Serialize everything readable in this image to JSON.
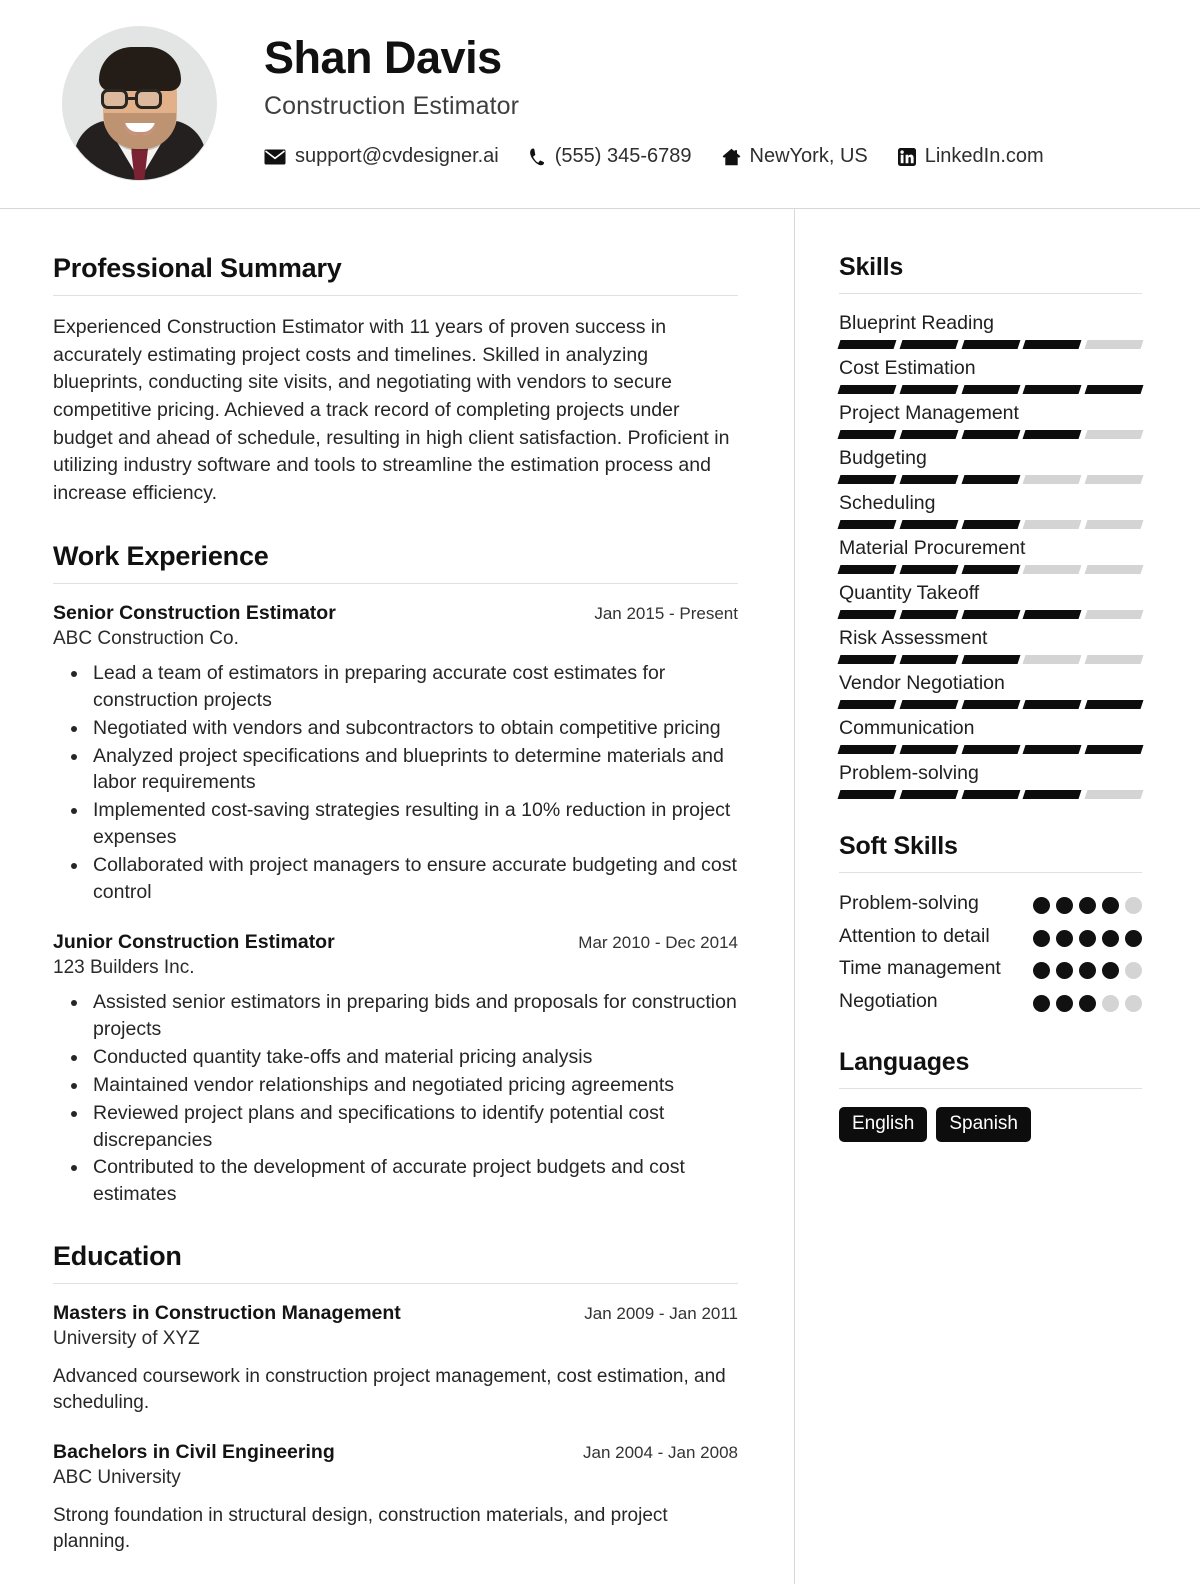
{
  "header": {
    "name": "Shan Davis",
    "role": "Construction Estimator",
    "avatar_alt": "profile-photo",
    "contacts": [
      {
        "icon": "envelope-icon",
        "label": "support@cvdesigner.ai"
      },
      {
        "icon": "phone-icon",
        "label": "(555) 345-6789"
      },
      {
        "icon": "home-icon",
        "label": "NewYork, US"
      },
      {
        "icon": "linkedin-icon",
        "label": "LinkedIn.com"
      }
    ]
  },
  "summary": {
    "title": "Professional Summary",
    "text": "Experienced Construction Estimator with 11 years of proven success in accurately estimating project costs and timelines. Skilled in analyzing blueprints, conducting site visits, and negotiating with vendors to secure competitive pricing. Achieved a track record of completing projects under budget and ahead of schedule, resulting in high client satisfaction. Proficient in utilizing industry software and tools to streamline the estimation process and increase efficiency."
  },
  "experience": {
    "title": "Work Experience",
    "entries": [
      {
        "title": "Senior Construction Estimator",
        "date": "Jan 2015 - Present",
        "org": "ABC Construction Co.",
        "bullets": [
          "Lead a team of estimators in preparing accurate cost estimates for construction projects",
          "Negotiated with vendors and subcontractors to obtain competitive pricing",
          "Analyzed project specifications and blueprints to determine materials and labor requirements",
          "Implemented cost-saving strategies resulting in a 10% reduction in project expenses",
          "Collaborated with project managers to ensure accurate budgeting and cost control"
        ]
      },
      {
        "title": "Junior Construction Estimator",
        "date": "Mar 2010 - Dec 2014",
        "org": "123 Builders Inc.",
        "bullets": [
          "Assisted senior estimators in preparing bids and proposals for construction projects",
          "Conducted quantity take-offs and material pricing analysis",
          "Maintained vendor relationships and negotiated pricing agreements",
          "Reviewed project plans and specifications to identify potential cost discrepancies",
          "Contributed to the development of accurate project budgets and cost estimates"
        ]
      }
    ]
  },
  "education": {
    "title": "Education",
    "entries": [
      {
        "title": "Masters in Construction Management",
        "date": "Jan 2009 - Jan 2011",
        "org": "University of XYZ",
        "desc": "Advanced coursework in construction project management, cost estimation, and scheduling."
      },
      {
        "title": "Bachelors in Civil Engineering",
        "date": "Jan 2004 - Jan 2008",
        "org": "ABC University",
        "desc": "Strong foundation in structural design, construction materials, and project planning."
      }
    ]
  },
  "skills": {
    "title": "Skills",
    "max": 5,
    "items": [
      {
        "name": "Blueprint Reading",
        "level": 4
      },
      {
        "name": "Cost Estimation",
        "level": 5
      },
      {
        "name": "Project Management",
        "level": 4
      },
      {
        "name": "Budgeting",
        "level": 3
      },
      {
        "name": "Scheduling",
        "level": 3
      },
      {
        "name": "Material Procurement",
        "level": 3
      },
      {
        "name": "Quantity Takeoff",
        "level": 4
      },
      {
        "name": "Risk Assessment",
        "level": 3
      },
      {
        "name": "Vendor Negotiation",
        "level": 5
      },
      {
        "name": "Communication",
        "level": 5
      },
      {
        "name": "Problem-solving",
        "level": 4
      }
    ]
  },
  "soft_skills": {
    "title": "Soft Skills",
    "max": 5,
    "items": [
      {
        "name": "Problem-solving",
        "level": 4
      },
      {
        "name": "Attention to detail",
        "level": 5
      },
      {
        "name": "Time management",
        "level": 4
      },
      {
        "name": "Negotiation",
        "level": 3
      }
    ]
  },
  "languages": {
    "title": "Languages",
    "items": [
      "English",
      "Spanish"
    ]
  },
  "colors": {
    "accent": "#0d0d0d",
    "muted_bar": "#d4d4d4",
    "rule": "#e0e0e0",
    "text": "#1a1a1a"
  }
}
